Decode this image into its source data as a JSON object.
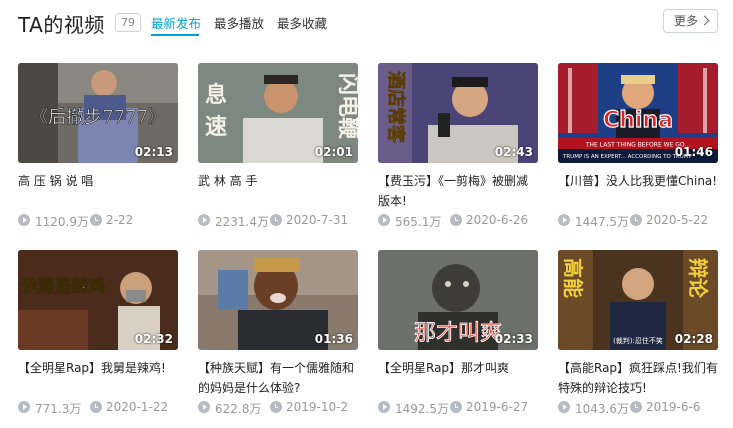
{
  "header": {
    "title": "TA的视频",
    "count": "79",
    "tabs": [
      "最新发布",
      "最多播放",
      "最多收藏"
    ],
    "more_label": "更多"
  },
  "colors": {
    "accent": "#00a1d6",
    "meta_text": "#999999"
  },
  "videos": [
    {
      "title": "高 压 锅 说 唱",
      "thumb_text": "《后撤步7777》",
      "duration": "02:13",
      "views": "1120.9万",
      "date": "2-22"
    },
    {
      "title": "武 林 高 手",
      "thumb_text": [
        "息",
        "速",
        "闪电鞭"
      ],
      "duration": "02:01",
      "views": "2231.4万",
      "date": "2020-7-31"
    },
    {
      "title": "【费玉污】《一剪梅》被删减版本!",
      "thumb_text": "酒店常客",
      "duration": "02:43",
      "views": "565.1万",
      "date": "2020-6-26"
    },
    {
      "title": "【川普】没人比我更懂China!",
      "thumb_text": [
        "China",
        "THE LAST THING BEFORE WE GO...",
        "TRUMP IS AN EXPERT... ACCORDING TO TRUMP"
      ],
      "duration": "01:46",
      "views": "1447.5万",
      "date": "2020-5-22"
    },
    {
      "title": "【全明星Rap】我舅是辣鸡!",
      "thumb_text": "我舅是辣鸡",
      "duration": "02:32",
      "views": "771.3万",
      "date": "2020-1-22"
    },
    {
      "title": "【种族天赋】有一个儒雅随和的妈妈是什么体验?",
      "thumb_text": "",
      "duration": "01:36",
      "views": "622.8万",
      "date": "2019-10-2"
    },
    {
      "title": "【全明星Rap】那才叫爽",
      "thumb_text": "那才叫爽",
      "duration": "02:33",
      "views": "1492.5万",
      "date": "2019-6-27"
    },
    {
      "title": "【高能Rap】疯狂踩点!我们有特殊的辩论技巧!",
      "thumb_text": [
        "高能",
        "辩论",
        "(裁判):忍住不笑"
      ],
      "duration": "02:28",
      "views": "1043.6万",
      "date": "2019-6-6"
    }
  ]
}
